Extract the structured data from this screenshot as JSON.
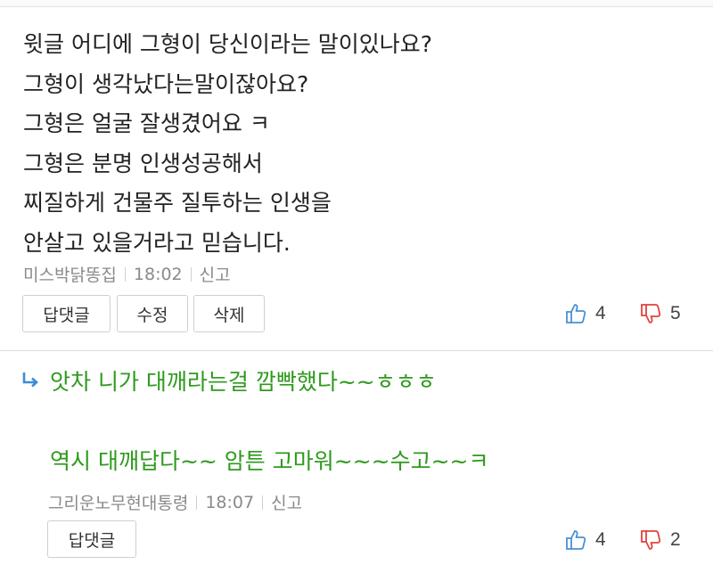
{
  "comment1": {
    "lines": [
      "윗글 어디에 그형이 당신이라는 말이있나요?",
      "그형이 생각났다는말이잖아요?",
      "그형은 얼굴 잘생겼어요 ㅋ",
      "그형은 분명 인생성공해서",
      "찌질하게 건물주 질투하는 인생을",
      "안살고 있을거라고 믿습니다."
    ],
    "author": "미스박닭똥집",
    "time": "18:02",
    "report_label": "신고",
    "reply_button": "답댓글",
    "edit_button": "수정",
    "delete_button": "삭제",
    "likes": "4",
    "dislikes": "5"
  },
  "comment2": {
    "reply_line": "앗차 니가 대깨라는걸 깜빡했다~~ㅎㅎㅎ",
    "body": "역시 대깨답다~~ 암튼 고마워~~~수고~~ㅋ",
    "author": "그리운노무현대통령",
    "time": "18:07",
    "report_label": "신고",
    "reply_button": "답댓글",
    "likes": "4",
    "dislikes": "2"
  },
  "colors": {
    "reply_text": "#2e9a1c",
    "like_icon": "#4a8fd4",
    "dislike_icon": "#e0433d",
    "reply_arrow": "#3d8bd8"
  },
  "icons": [
    "thumbs-up-icon",
    "thumbs-down-icon",
    "reply-arrow-icon"
  ]
}
